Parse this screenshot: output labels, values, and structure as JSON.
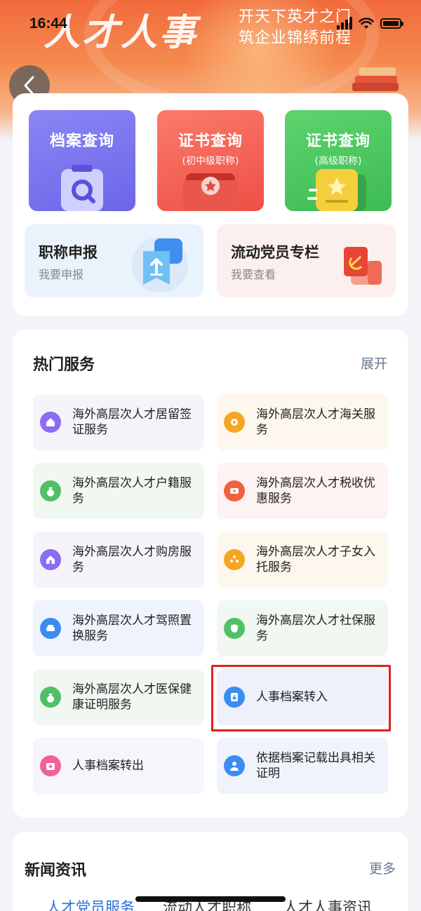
{
  "status_bar": {
    "time": "16:44"
  },
  "banner": {
    "title": "人才人事",
    "slogan_line1": "开天下英才之门",
    "slogan_line2": "筑企业锦绣前程"
  },
  "quick_tiles": [
    {
      "title": "档案查询",
      "subtitle": "",
      "color": "#7f7cf0"
    },
    {
      "title": "证书查询",
      "subtitle": "(初中级职称)",
      "color": "#f56a5a"
    },
    {
      "title": "证书查询",
      "subtitle": "(高级职称)",
      "color": "#52c763"
    }
  ],
  "wide_tiles": [
    {
      "title": "职称申报",
      "subtitle": "我要申报"
    },
    {
      "title": "流动党员专栏",
      "subtitle": "我要查看"
    }
  ],
  "hot_services": {
    "title": "热门服务",
    "expand_label": "展开",
    "items": [
      {
        "label": "海外高层次人才居留签证服务",
        "icon": "home-icon",
        "icon_color": "#8b6cf2",
        "bg": "#f5f4fb"
      },
      {
        "label": "海外高层次人才海关服务",
        "icon": "customs-icon",
        "icon_color": "#f5a623",
        "bg": "#fdf7ee"
      },
      {
        "label": "海外高层次人才户籍服务",
        "icon": "money-bag-icon",
        "icon_color": "#4fc066",
        "bg": "#f1f8f2"
      },
      {
        "label": "海外高层次人才税收优惠服务",
        "icon": "ticket-icon",
        "icon_color": "#f2603f",
        "bg": "#fdf3f2"
      },
      {
        "label": "海外高层次人才购房服务",
        "icon": "house-icon",
        "icon_color": "#8b6cf2",
        "bg": "#f5f4fb"
      },
      {
        "label": "海外高层次人才子女入托服务",
        "icon": "family-icon",
        "icon_color": "#f5a623",
        "bg": "#fdf7ee"
      },
      {
        "label": "海外高层次人才驾照置换服务",
        "icon": "car-icon",
        "icon_color": "#3b8cf0",
        "bg": "#eff4fc"
      },
      {
        "label": "海外高层次人才社保服务",
        "icon": "shield-icon",
        "icon_color": "#4fc066",
        "bg": "#f1f8f2"
      },
      {
        "label": "海外高层次人才医保健康证明服务",
        "icon": "money-bag-icon",
        "icon_color": "#4fc066",
        "bg": "#f1f8f2"
      },
      {
        "label": "人事档案转入",
        "icon": "file-in-icon",
        "icon_color": "#3b8cf0",
        "bg": "#eef0fb"
      },
      {
        "label": "人事档案转出",
        "icon": "medical-kit-icon",
        "icon_color": "#f06292",
        "bg": "#f7f5fb"
      },
      {
        "label": "依据档案记载出具相关证明",
        "icon": "person-icon",
        "icon_color": "#3b8cf0",
        "bg": "#eff4fc"
      }
    ]
  },
  "news": {
    "title": "新闻资讯",
    "more_label": "更多",
    "tabs": [
      "人才党员服务",
      "流动人才职称",
      "人才人事资讯"
    ]
  }
}
